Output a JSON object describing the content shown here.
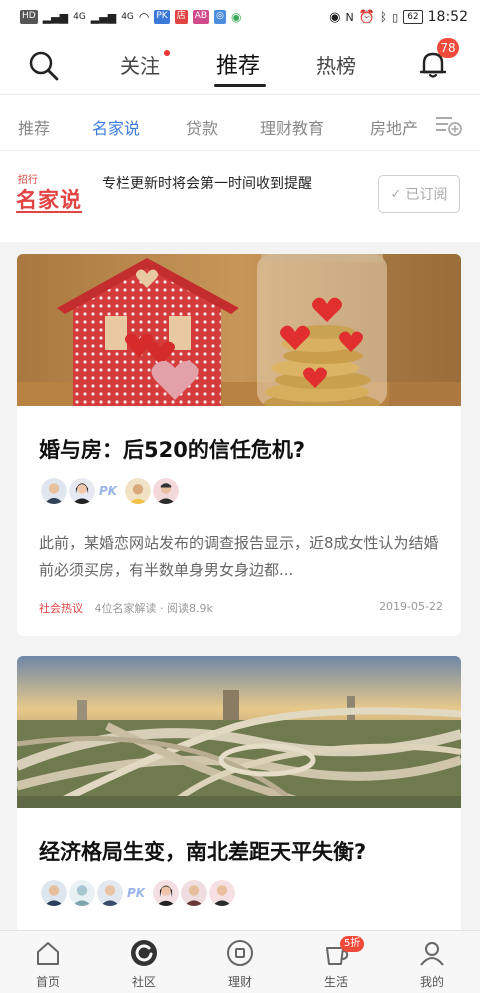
{
  "status_bar": {
    "left_chips": [
      "HD",
      "4G",
      "4G"
    ],
    "app_chips": [
      "PK",
      "店",
      "AB"
    ],
    "battery": "62",
    "time": "18:52"
  },
  "top_nav": {
    "tabs": [
      "关注",
      "推荐",
      "热榜"
    ],
    "active_tab": "推荐",
    "notification_count": "78"
  },
  "categories": {
    "items": [
      "推荐",
      "名家说",
      "贷款",
      "理财教育",
      "房地产"
    ],
    "active": "名家说"
  },
  "subscription": {
    "logo_small": "招行",
    "logo_big": "名家说",
    "text": "专栏更新时将会第一时间收到提醒",
    "button_label": "已订阅"
  },
  "articles": [
    {
      "title": "婚与房：后520的信任危机?",
      "pk_label": "PK",
      "summary": "此前，某婚恋网站发布的调查报告显示，近8成女性认为结婚前必须买房，有半数单身男女身边都...",
      "tag": "社会热议",
      "info": "4位名家解读 · 阅读8.9k",
      "date": "2019-05-22"
    },
    {
      "title": "经济格局生变，南北差距天平失衡?",
      "pk_label": "PK"
    }
  ],
  "bottom_nav": {
    "items": [
      "首页",
      "社区",
      "理财",
      "生活",
      "我的"
    ],
    "life_badge": "5折"
  },
  "colors": {
    "accent_blue": "#3d7de0",
    "brand_red": "#e24343",
    "badge_red": "#f04b3a"
  }
}
